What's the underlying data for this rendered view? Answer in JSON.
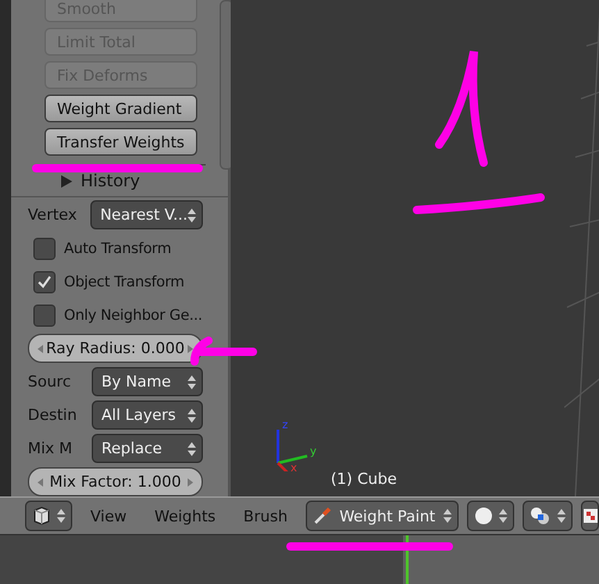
{
  "tool_buttons": [
    {
      "label": "Smooth",
      "disabled": true
    },
    {
      "label": "Limit Total",
      "disabled": true
    },
    {
      "label": "Fix Deforms",
      "disabled": true
    },
    {
      "label": "Weight Gradient",
      "disabled": false
    },
    {
      "label": "Transfer Weights",
      "disabled": false
    }
  ],
  "history": {
    "label": "History",
    "expanded": false
  },
  "operator_rows": [
    {
      "kind": "dropdown",
      "label": "Vertex",
      "value": "Nearest V..."
    },
    {
      "kind": "checkbox",
      "label": "Auto Transform",
      "checked": false
    },
    {
      "kind": "checkbox",
      "label": "Object Transform",
      "checked": true
    },
    {
      "kind": "checkbox",
      "label": "Only Neighbor Ge...",
      "checked": false
    },
    {
      "kind": "slider",
      "label": "Ray Radius:",
      "value": "0.000"
    },
    {
      "kind": "dropdown",
      "label": "Sourc",
      "value": "By Name"
    },
    {
      "kind": "dropdown",
      "label": "Destin",
      "value": "All Layers"
    },
    {
      "kind": "dropdown",
      "label": "Mix M",
      "value": "Replace"
    },
    {
      "kind": "slider",
      "label": "Mix Factor:",
      "value": "1.000"
    }
  ],
  "viewport": {
    "axes": [
      "z",
      "y",
      "x"
    ],
    "object_label": "(1) Cube"
  },
  "header": {
    "menus": [
      "View",
      "Weights",
      "Brush"
    ],
    "mode": "Weight Paint"
  }
}
